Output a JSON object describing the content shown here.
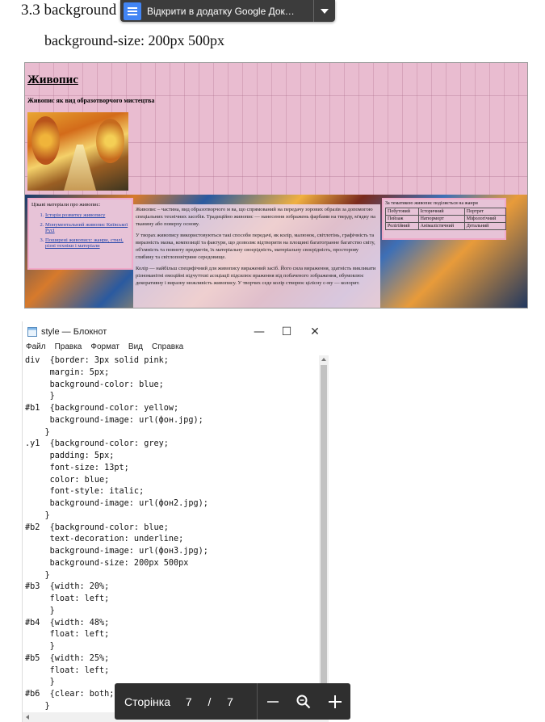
{
  "document": {
    "heading": "3.3  background",
    "line": "background-size: 200px 500px"
  },
  "open_button": {
    "label": "Відкрити в додатку Google Док…"
  },
  "webpage": {
    "title": "Живопис",
    "subtitle": "Живопис як вид образотворчого мистецтва",
    "left_heading": "Цікаві матеріали про живопис:",
    "links": [
      "Історія розвитку живопису",
      "Монументальний живопис Київської Русі",
      "Поширені живопису: жанри, стилі, різні техніки і матеріали"
    ],
    "paragraphs": [
      "Живопис – частина, вид образотворчого м ва, що спрямований на передачу зорових образів за допомогою спеціальних технічних засобів. Традиційно живопис — нанесення зображень фарбами на тверду, м'ядку на тканину або поверху основу.",
      "У творах живопису використовуються такі способи передачі, як колір, малюнок, світлотінь, графічність та виразність мазка, композиції та фактури, що дозволяє відтворити на площині багатогранне багатство світу, об'ємність та повноту предметів, їх матеріальну своєрідність, матеріальну своєрідність, просторову глибину та світлоповітряне середовище.",
      "Колір — найбільш специфічний для живопису виражений засіб. Його сила вираження, здатність викликати різноманітні емоційні відчуттєві асоціації підсилює враження від побаченого зображення, обумовлює декоративну і виразну можливість живопису. У творчих седе колір створює цілісну с-му — колорит."
    ],
    "right_heading": "За тематикою живопис поділяється на жанри",
    "genres": [
      [
        "Побутовий",
        "Історичний",
        "Портрет"
      ],
      [
        "Пейзаж",
        "Натюрморт",
        "Міфологічний"
      ],
      [
        "Релігійний",
        "Анімалістичний",
        "Детальний"
      ]
    ]
  },
  "notepad": {
    "title": "style — Блокнот",
    "menu": [
      "Файл",
      "Правка",
      "Формат",
      "Вид",
      "Справка"
    ],
    "minimize_glyph": "—",
    "maximize_glyph": "☐",
    "close_glyph": "✕",
    "code_lines": [
      "div  {border: 3px solid pink;",
      "     margin: 5px;",
      "     background-color: blue;",
      "     }",
      "#b1  {background-color: yellow;",
      "     background-image: url(фон.jpg);",
      "    }",
      ".y1  {background-color: grey;",
      "     padding: 5px;",
      "     font-size: 13pt;",
      "     color: blue;",
      "     font-style: italic;",
      "     background-image: url(фон2.jpg);",
      "    }",
      "#b2  {background-color: blue;",
      "     text-decoration: underline;",
      "     background-image: url(фон3.jpg);",
      "     background-size: 200px 500px",
      "    }",
      "#b3  {width: 20%;",
      "     float: left;",
      "     }",
      "#b4  {width: 48%;",
      "     float: left;",
      "     }",
      "#b5  {width: 25%;",
      "     float: left;",
      "     }",
      "#b6  {clear: both;",
      "    }"
    ]
  },
  "pagebar": {
    "label": "Сторінка",
    "current": "7",
    "separator": "/",
    "total": "7"
  }
}
